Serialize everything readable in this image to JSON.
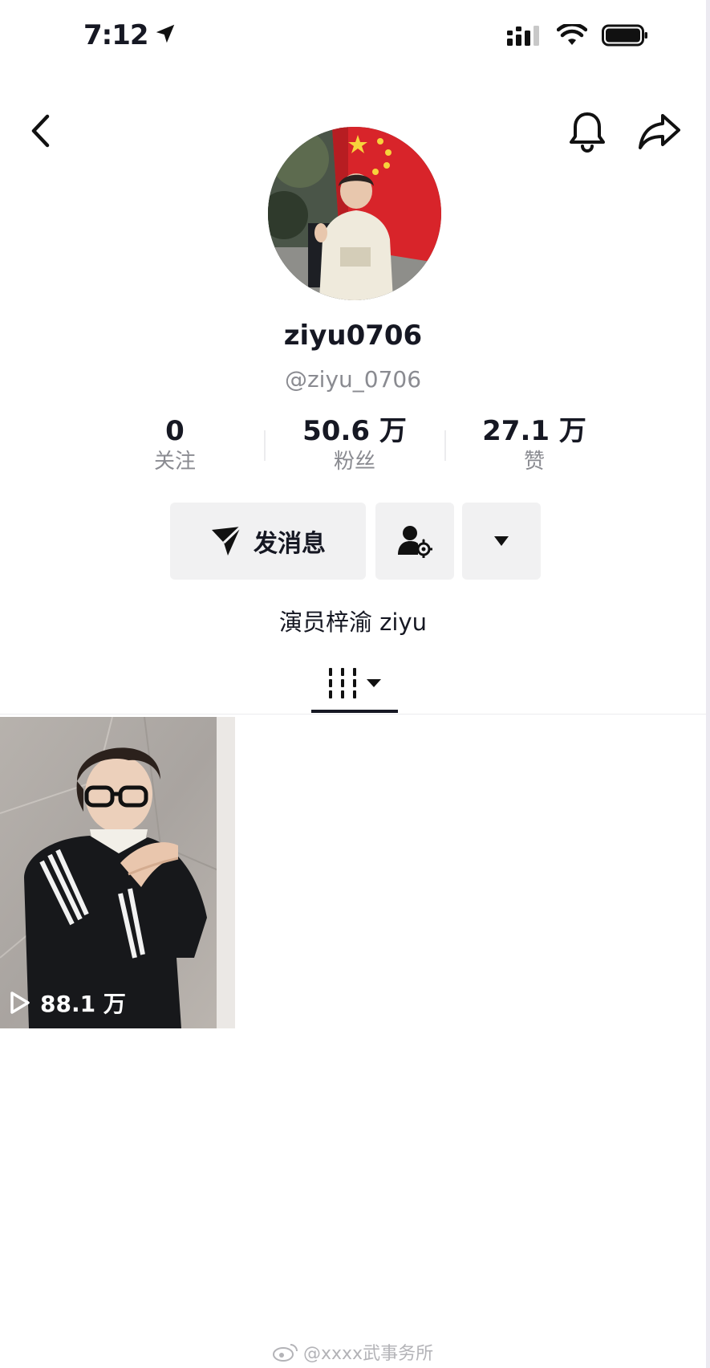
{
  "status_bar": {
    "time": "7:12"
  },
  "profile": {
    "username": "ziyu0706",
    "handle": "@ziyu_0706",
    "bio": "演员梓渝 ziyu"
  },
  "stats": [
    {
      "value": "0",
      "label": "关注"
    },
    {
      "value": "50.6 万",
      "label": "粉丝"
    },
    {
      "value": "27.1 万",
      "label": "赞"
    }
  ],
  "actions": {
    "message_label": "发消息"
  },
  "videos": [
    {
      "views": "88.1 万"
    }
  ],
  "watermark": {
    "text": "@xxxx武事务所"
  },
  "colors": {
    "text": "#161823",
    "muted": "#8a8b91",
    "button_bg": "#f1f1f2",
    "flag_red": "#d8242a"
  }
}
